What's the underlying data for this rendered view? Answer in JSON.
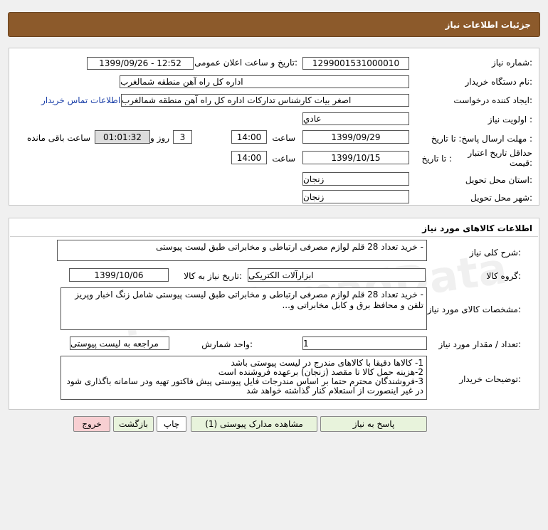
{
  "header": {
    "title": "جزئیات اطلاعات نیاز"
  },
  "info": {
    "need_number_label": "شماره نیاز:",
    "need_number": "1299001531000010",
    "announce_label": "تاریخ و ساعت اعلان عمومی:",
    "announce_value": "1399/09/26 - 12:52",
    "buyer_label": "نام دستگاه خریدار:",
    "buyer_value": "اداره کل راه آهن منطقه شمالغرب",
    "creator_label": "ایجاد کننده درخواست:",
    "creator_value": "اصغر بیات کارشناس تدارکات اداره کل راه آهن منطقه شمالغرب",
    "contact_link": "اطلاعات تماس خریدار",
    "priority_label": "اولویت نیاز :",
    "priority_value": "عادي",
    "deadline_label": "مهلت ارسال پاسخ:  تا تاریخ :",
    "deadline_date": "1399/09/29",
    "time_label": "ساعت",
    "deadline_time": "14:00",
    "days_value": "3",
    "days_label": "روز و",
    "remaining_value": "01:01:32",
    "remaining_label": "ساعت باقی مانده",
    "validity_label": "حداقل تاریخ اعتبار قیمت:",
    "validity_to_label": "تا تاریخ :",
    "validity_date": "1399/10/15",
    "validity_time_label": "ساعت",
    "validity_time": "14:00",
    "province_label": "استان محل تحویل:",
    "province_value": "زنجان",
    "city_label": "شهر محل تحویل:",
    "city_value": "زنجان"
  },
  "goods": {
    "section_title": "اطلاعات کالاهای مورد نیاز",
    "summary_label": "شرح کلی نیاز:",
    "summary_value": "- خرید تعداد 28 قلم لوازم مصرفی ارتباطی و مخابراتی طبق لیست پیوستی",
    "group_label": "گروه کالا:",
    "group_value": "ابزارآلات الکتریکی",
    "need_date_label": "تاریخ نیاز به کالا:",
    "need_date_value": "1399/10/06",
    "specs_label": "مشخصات کالای مورد نیاز:",
    "specs_value": "- خرید تعداد 28 قلم لوازم مصرفی ارتباطی و مخابراتی طبق لیست پیوستی شامل زنگ اخبار وپریز تلفن و محافظ برق و کابل مخابراتی و...",
    "qty_label": "تعداد / مقدار مورد نیاز:",
    "qty_value": "1",
    "unit_label": "واحد شمارش:",
    "unit_value": "مراجعه به لیست پیوستی",
    "notes_label": "توضیحات خریدار:",
    "notes_lines": [
      "1- کالاها دقیقا با کالاهای مندرج در لیست پیوستی باشد",
      "2-هزینه حمل کالا تا مقصد (زنجان) برعهده فروشنده است",
      "3-فروشندگان محترم حتما بر اساس مندرجات فایل پیوستی پیش فاکتور تهیه ودر سامانه باگذاری شود",
      "در غیر اینصورت از استعلام کنار گذاشته خواهد شد"
    ]
  },
  "buttons": {
    "reply": "پاسخ به نیاز",
    "attachments": "مشاهده مدارک پیوستی (1)",
    "print": "چاپ",
    "back": "بازگشت",
    "exit": "خروج"
  }
}
